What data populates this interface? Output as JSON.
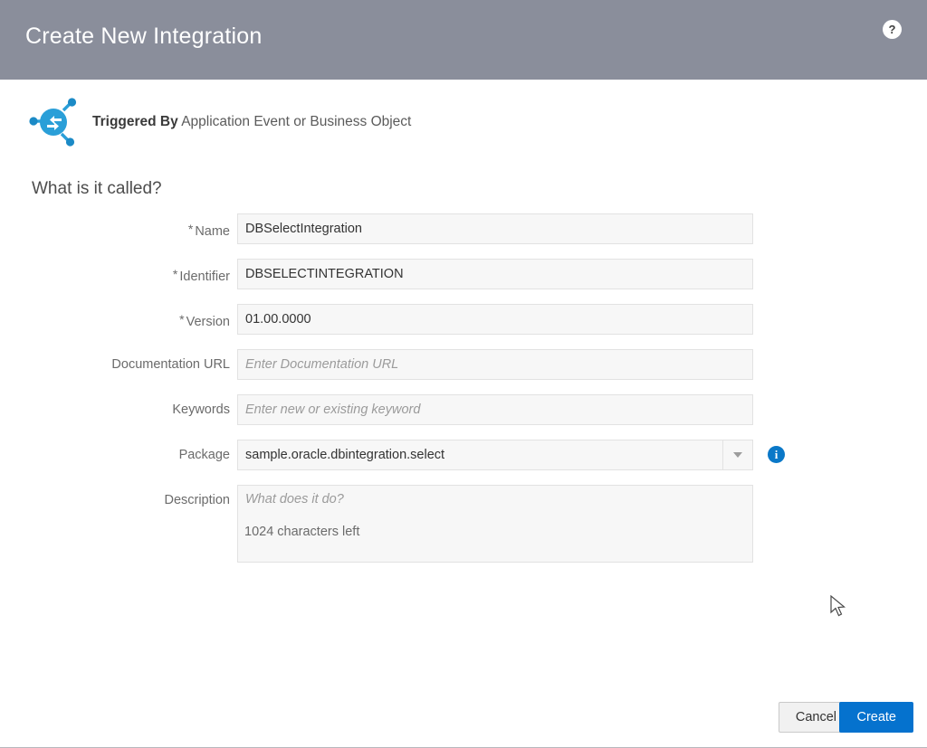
{
  "window": {
    "title": "Create New Integration",
    "help_icon_label": "?"
  },
  "trigger": {
    "label": "Triggered By",
    "value": "Application Event or Business Object",
    "icon": "integration-nodes-icon"
  },
  "section": {
    "heading": "What is it called?"
  },
  "fields": {
    "name": {
      "label": "Name",
      "required": true,
      "value": "DBSelectIntegration",
      "placeholder": ""
    },
    "identifier": {
      "label": "Identifier",
      "required": true,
      "value": "DBSELECTINTEGRATION",
      "placeholder": ""
    },
    "version": {
      "label": "Version",
      "required": true,
      "value": "01.00.0000",
      "placeholder": ""
    },
    "documentation_url": {
      "label": "Documentation URL",
      "required": false,
      "value": "",
      "placeholder": "Enter Documentation URL"
    },
    "keywords": {
      "label": "Keywords",
      "required": false,
      "value": "",
      "placeholder": "Enter new or existing keyword"
    },
    "package": {
      "label": "Package",
      "required": false,
      "value": "sample.oracle.dbintegration.select",
      "placeholder": "",
      "info_icon_label": "i",
      "dropdown_icon": "chevron-down-icon"
    },
    "description": {
      "label": "Description",
      "required": false,
      "value": "",
      "placeholder": "What does it do?",
      "char_count": "1024 characters left"
    }
  },
  "footer": {
    "cancel_label": "Cancel",
    "create_label": "Create"
  },
  "colors": {
    "header_bg": "#8a8e9b",
    "accent_blue": "#0572ce",
    "info_blue": "#0a78c8",
    "icon_blue": "#2a9fd8"
  }
}
